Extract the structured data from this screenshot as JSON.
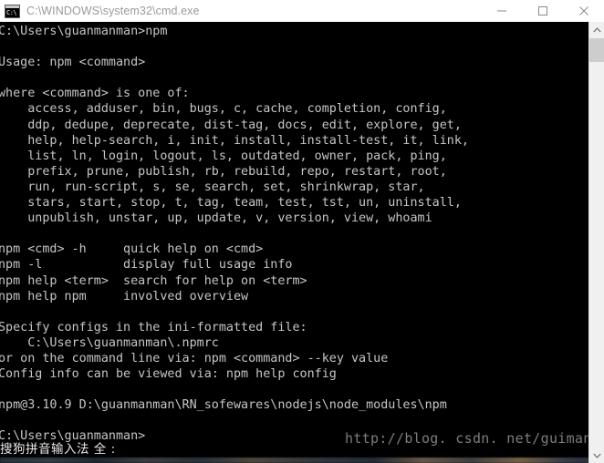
{
  "window": {
    "title": "C:\\WINDOWS\\system32\\cmd.exe",
    "icon_name": "cmd-console-icon",
    "icon_glyph": "C:\\",
    "titlebar_background": "#ffffff",
    "title_color": "#9a9a9a",
    "console_background": "#000000",
    "console_foreground": "#c6c6c6"
  },
  "controls": {
    "minimize_label": "Minimize",
    "maximize_label": "Maximize",
    "close_label": "Close"
  },
  "console": {
    "lines": [
      "C:\\Users\\guanmanman>npm",
      "",
      "Usage: npm <command>",
      "",
      "where <command> is one of:",
      "    access, adduser, bin, bugs, c, cache, completion, config,",
      "    ddp, dedupe, deprecate, dist-tag, docs, edit, explore, get,",
      "    help, help-search, i, init, install, install-test, it, link,",
      "    list, ln, login, logout, ls, outdated, owner, pack, ping,",
      "    prefix, prune, publish, rb, rebuild, repo, restart, root,",
      "    run, run-script, s, se, search, set, shrinkwrap, star,",
      "    stars, start, stop, t, tag, team, test, tst, un, uninstall,",
      "    unpublish, unstar, up, update, v, version, view, whoami",
      "",
      "npm <cmd> -h     quick help on <cmd>",
      "npm -l           display full usage info",
      "npm help <term>  search for help on <term>",
      "npm help npm     involved overview",
      "",
      "Specify configs in the ini-formatted file:",
      "    C:\\Users\\guanmanman\\.npmrc",
      "or on the command line via: npm <command> --key value",
      "Config info can be viewed via: npm help config",
      "",
      "npm@3.10.9 D:\\guanmanman\\RN_sofewares\\nodejs\\node_modules\\npm",
      "",
      "C:\\Users\\guanmanman>"
    ],
    "prompt_current": "C:\\Users\\guanmanman>",
    "npm_version_line": "npm@3.10.9 D:\\guanmanman\\RN_sofewares\\nodejs\\node_modules\\npm"
  },
  "watermark": {
    "text": "http://blog. csdn. net/guiman",
    "color": "#7f7d7a"
  },
  "ime": {
    "text": "搜狗拼音输入法 全 :"
  },
  "scrollbar": {
    "up_arrow_glyph": "⌃",
    "down_arrow_glyph": "⌄",
    "thumb_color": "#cdcdcd",
    "track_color": "#f0f0f0"
  }
}
